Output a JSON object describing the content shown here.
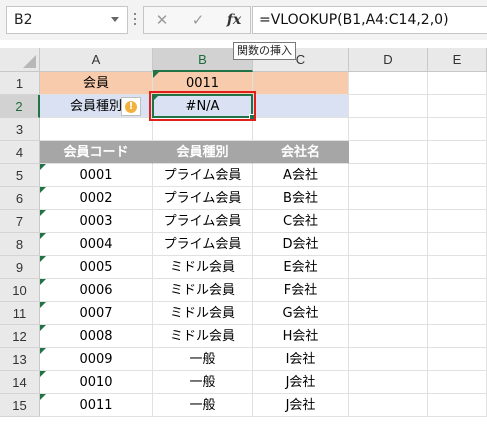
{
  "formula_bar": {
    "name_box": "B2",
    "formula": "=VLOOKUP(B1,A4:C14,2,0)",
    "tooltip": "関数の挿入",
    "cancel_icon": "✕",
    "enter_icon": "✓",
    "insert_function_icon": "fx"
  },
  "columns": [
    "A",
    "B",
    "C",
    "D",
    "E"
  ],
  "rows": [
    "1",
    "2",
    "3",
    "4",
    "5",
    "6",
    "7",
    "8",
    "9",
    "10",
    "11",
    "12",
    "13",
    "14",
    "15"
  ],
  "lookup": {
    "a1": "会員",
    "b1": "0011",
    "a2": "会員種別",
    "b2": "#N/A"
  },
  "table": {
    "headers": [
      "会員コード",
      "会員種別",
      "会社名"
    ],
    "rows": [
      [
        "0001",
        "プライム会員",
        "A会社"
      ],
      [
        "0002",
        "プライム会員",
        "B会社"
      ],
      [
        "0003",
        "プライム会員",
        "C会社"
      ],
      [
        "0004",
        "プライム会員",
        "D会社"
      ],
      [
        "0005",
        "ミドル会員",
        "E会社"
      ],
      [
        "0006",
        "ミドル会員",
        "F会社"
      ],
      [
        "0007",
        "ミドル会員",
        "G会社"
      ],
      [
        "0008",
        "ミドル会員",
        "H会社"
      ],
      [
        "0009",
        "一般",
        "I会社"
      ],
      [
        "0010",
        "一般",
        "J会社"
      ],
      [
        "0011",
        "一般",
        "J会社"
      ]
    ]
  },
  "colors": {
    "header_fill": "#a6a6a6",
    "lookup_label_fill": "#f8cbad",
    "lookup_result_fill": "#d9e1f2",
    "selection": "#217346",
    "highlight_box": "#e0201b",
    "warning": "#f2b13d"
  }
}
